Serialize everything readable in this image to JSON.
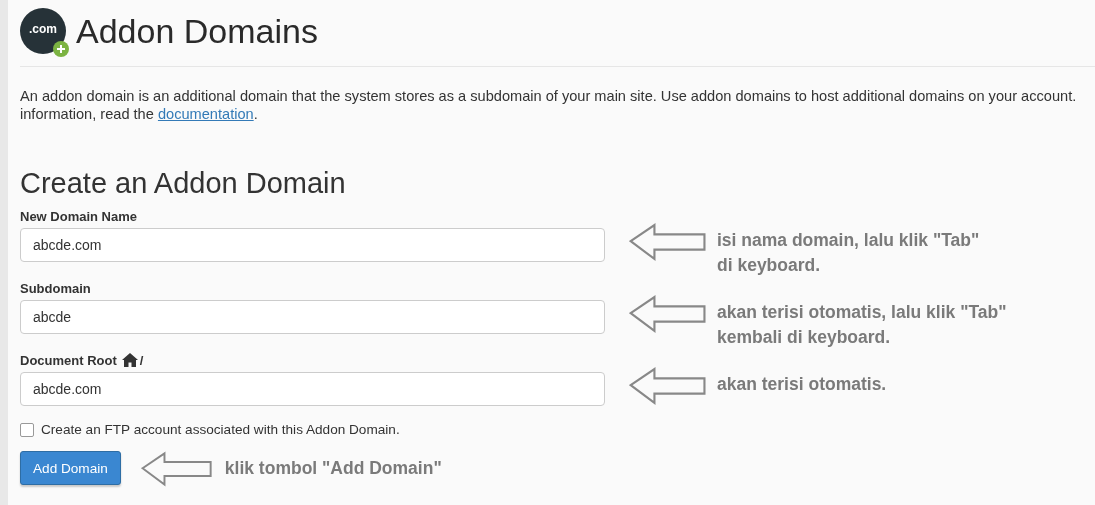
{
  "header": {
    "icon_text": ".com",
    "title": "Addon Domains"
  },
  "description": {
    "line_1": "An addon domain is an additional domain that the system stores as a subdomain of your main site. Use addon domains to host additional domains on your account.",
    "line_2": "information, read the",
    "link": "documentation",
    "end": "."
  },
  "form": {
    "title": "Create an Addon Domain",
    "fields": [
      {
        "label": "New Domain Name",
        "value": "abcde.com",
        "note": [
          "isi nama domain, lalu klik \"Tab\"",
          "di keyboard."
        ]
      },
      {
        "label": "Subdomain",
        "value": "abcde",
        "note": [
          "akan terisi otomatis, lalu klik \"Tab\"",
          "kembali di keyboard."
        ]
      },
      {
        "label": "Document Root",
        "label_suffix": "/",
        "home_icon": true,
        "value": "abcde.com",
        "note": [
          "akan terisi otomatis."
        ]
      }
    ],
    "ftp_checkbox": {
      "label": "Create an FTP account associated with this Addon Domain.",
      "checked": false
    },
    "submit": {
      "label": "Add Domain",
      "note": "klik tombol \"Add Domain\""
    }
  }
}
